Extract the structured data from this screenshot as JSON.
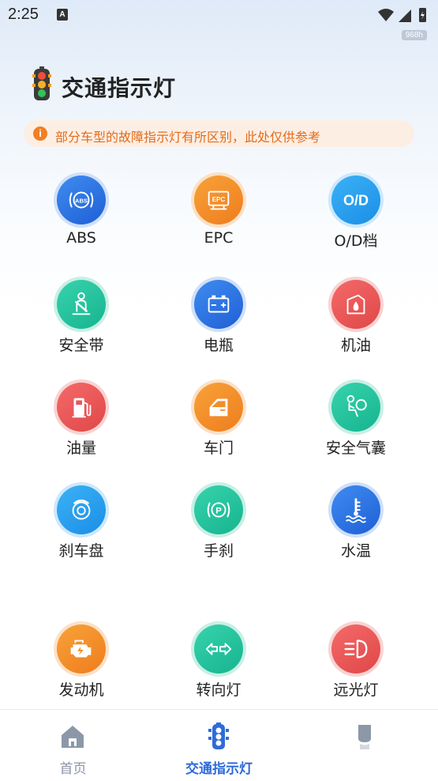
{
  "status": {
    "time": "2:25",
    "notif_glyph": "A",
    "chip": "968h"
  },
  "header": {
    "title": "交通指示灯",
    "icon": "traffic-light-icon"
  },
  "notice": {
    "text": "部分车型的故障指示灯有所区别，此处仅供参考",
    "icon": "info-icon"
  },
  "grid": [
    {
      "label": "ABS",
      "icon": "abs-icon",
      "color": "#2f73e3"
    },
    {
      "label": "EPC",
      "icon": "epc-icon",
      "color": "#f28e2b"
    },
    {
      "label": "O/D档",
      "icon": "od-icon",
      "color": "#1a8ee6",
      "glyph": "O/D"
    },
    {
      "label": "安全带",
      "icon": "seatbelt-icon",
      "color": "#1fc39b"
    },
    {
      "label": "电瓶",
      "icon": "battery-icon",
      "color": "#2f73e3"
    },
    {
      "label": "机油",
      "icon": "oil-icon",
      "color": "#e95757"
    },
    {
      "label": "油量",
      "icon": "fuel-icon",
      "color": "#e95757"
    },
    {
      "label": "车门",
      "icon": "door-icon",
      "color": "#f28e2b"
    },
    {
      "label": "安全气囊",
      "icon": "airbag-icon",
      "color": "#1fc39b"
    },
    {
      "label": "刹车盘",
      "icon": "brake-disc-icon",
      "color": "#1a8ee6"
    },
    {
      "label": "手刹",
      "icon": "handbrake-icon",
      "color": "#1fc39b"
    },
    {
      "label": "水温",
      "icon": "water-temp-icon",
      "color": "#2f73e3"
    },
    {
      "label": "发动机",
      "icon": "engine-icon",
      "color": "#f28e2b"
    },
    {
      "label": "转向灯",
      "icon": "turn-signal-icon",
      "color": "#1fc39b"
    },
    {
      "label": "远光灯",
      "icon": "high-beam-icon",
      "color": "#e95757"
    }
  ],
  "tabbar": [
    {
      "label": "首页",
      "icon": "home-icon",
      "active": false
    },
    {
      "label": "交通指示灯",
      "icon": "traffic-light-icon",
      "active": true
    },
    {
      "label": "",
      "icon": "profile-icon",
      "active": false
    }
  ],
  "colors": {
    "accent": "#2f6bd9",
    "notice_text": "#e36c1a",
    "notice_bg": "#fdeee4"
  }
}
